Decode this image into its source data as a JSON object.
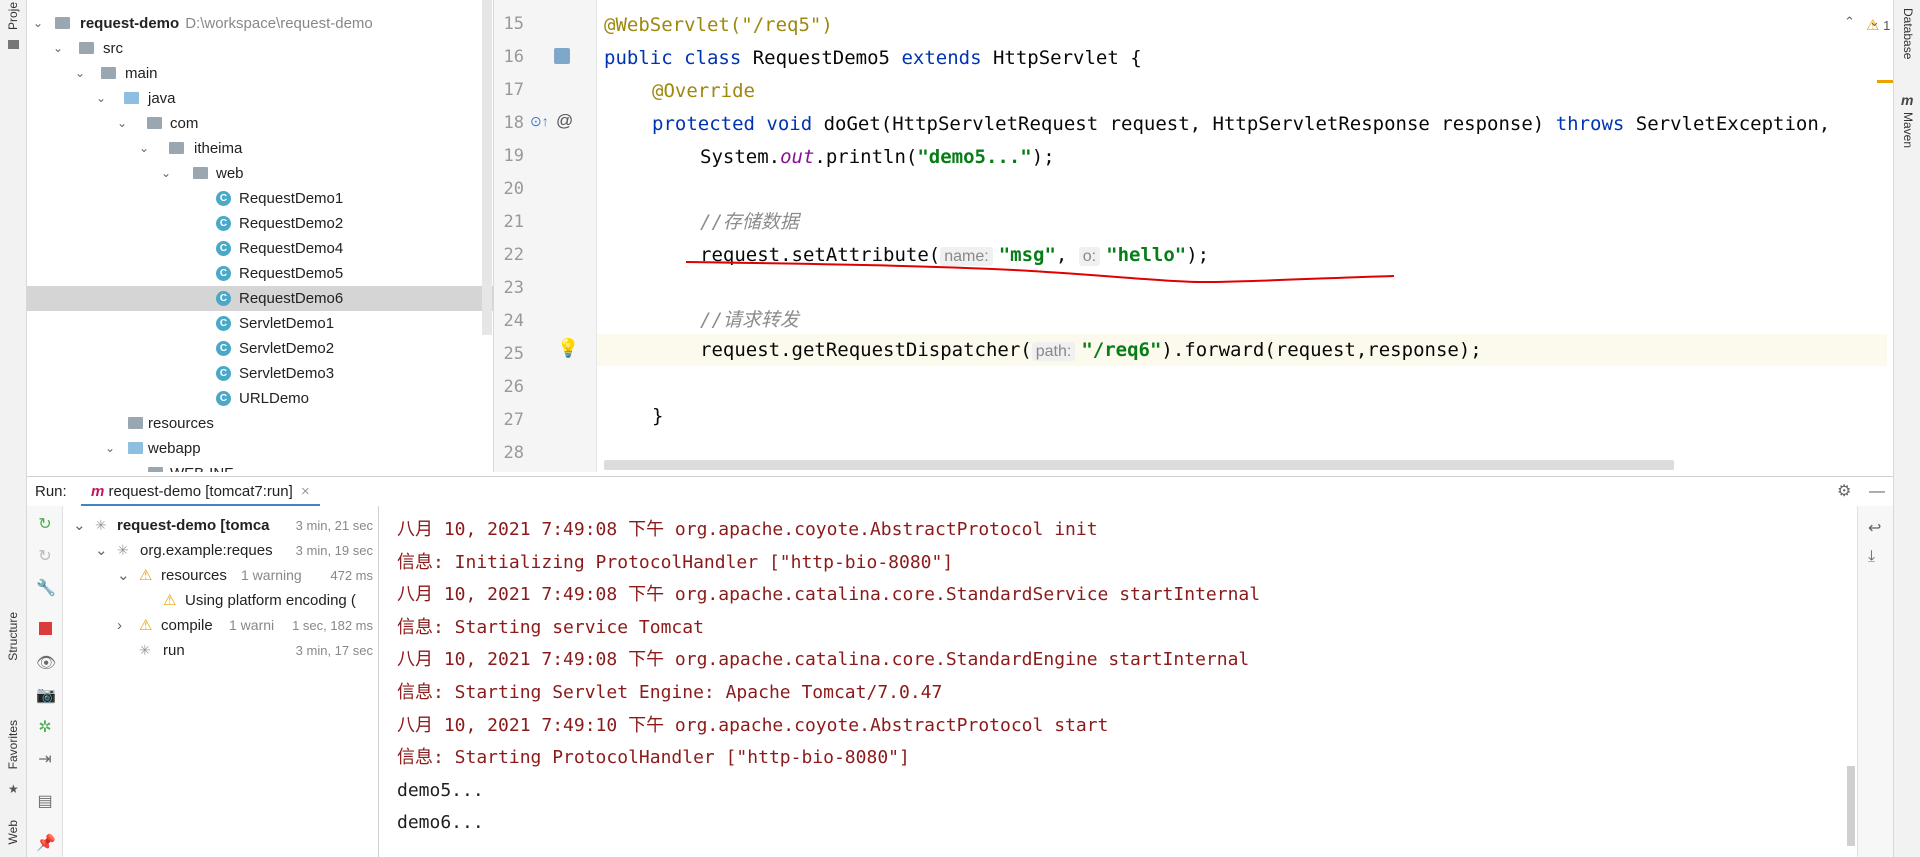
{
  "left_stripe": {
    "project_label": "Proje",
    "structure_label": "Structure",
    "favorites_label": "Favorites",
    "web_label": "Web"
  },
  "right_stripe": {
    "database_label": "Database",
    "maven_label": "Maven"
  },
  "project_tree": {
    "root_name": "request-demo",
    "root_path": "D:\\workspace\\request-demo",
    "items": [
      {
        "label": "src"
      },
      {
        "label": "main"
      },
      {
        "label": "java"
      },
      {
        "label": "com"
      },
      {
        "label": "itheima"
      },
      {
        "label": "web"
      },
      {
        "label": "RequestDemo1"
      },
      {
        "label": "RequestDemo2"
      },
      {
        "label": "RequestDemo4"
      },
      {
        "label": "RequestDemo5"
      },
      {
        "label": "RequestDemo6"
      },
      {
        "label": "ServletDemo1"
      },
      {
        "label": "ServletDemo2"
      },
      {
        "label": "ServletDemo3"
      },
      {
        "label": "URLDemo"
      },
      {
        "label": "resources"
      },
      {
        "label": "webapp"
      },
      {
        "label": "WEB-INF"
      }
    ]
  },
  "editor": {
    "warning_count": "1",
    "line_numbers": [
      "15",
      "16",
      "17",
      "18",
      "19",
      "20",
      "21",
      "22",
      "23",
      "24",
      "25",
      "26",
      "27",
      "28"
    ],
    "code": {
      "l15": "@WebServlet(\"/req5\")",
      "l16_kw": "public class",
      "l16_rest": " RequestDemo5 ",
      "l16_kw2": "extends",
      "l16_end": " HttpServlet {",
      "l17": "@Override",
      "l18_kw": "protected void",
      "l18_rest": " doGet(HttpServletRequest request, HttpServletResponse response) ",
      "l18_kw2": "throws",
      "l18_end": " ServletException,",
      "l19_a": "System.",
      "l19_static": "out",
      "l19_b": ".println(",
      "l19_str": "\"demo5...\"",
      "l19_c": ");",
      "l21_comment": "//存储数据",
      "l22_a": "request.setAttribute(",
      "l22_hint1": "name:",
      "l22_str1": "\"msg\"",
      "l22_sep": ", ",
      "l22_hint2": "o:",
      "l22_str2": "\"hello\"",
      "l22_c": ");",
      "l24_comment": "//请求转发",
      "l25_a": "request.getRequestDispatcher(",
      "l25_hint": "path:",
      "l25_str": "\"/req6\"",
      "l25_c": ").forward(request,response);",
      "l27": "}"
    }
  },
  "run_panel": {
    "run_label": "Run:",
    "tab_label": "request-demo [tomcat7:run]",
    "build_tree": [
      {
        "label": "request-demo [tomca",
        "time": "3 min, 21 sec"
      },
      {
        "label": "org.example:reques",
        "time": "3 min, 19 sec"
      },
      {
        "label": "resources",
        "extra": "1 warning",
        "time": "472 ms"
      },
      {
        "label": "Using platform encoding (",
        "time": ""
      },
      {
        "label": "compile",
        "extra": "1 warni",
        "time": "1 sec, 182 ms"
      },
      {
        "label": "run",
        "time": "3 min, 17 sec"
      }
    ],
    "console_lines": [
      {
        "text": "八月 10, 2021 7:49:08 下午 org.apache.coyote.AbstractProtocol init",
        "style": "red"
      },
      {
        "text": "信息: Initializing ProtocolHandler [\"http-bio-8080\"]",
        "style": "red"
      },
      {
        "text": "八月 10, 2021 7:49:08 下午 org.apache.catalina.core.StandardService startInternal",
        "style": "red"
      },
      {
        "text": "信息: Starting service Tomcat",
        "style": "red"
      },
      {
        "text": "八月 10, 2021 7:49:08 下午 org.apache.catalina.core.StandardEngine startInternal",
        "style": "red"
      },
      {
        "text": "信息: Starting Servlet Engine: Apache Tomcat/7.0.47",
        "style": "red"
      },
      {
        "text": "八月 10, 2021 7:49:10 下午 org.apache.coyote.AbstractProtocol start",
        "style": "red"
      },
      {
        "text": "信息: Starting ProtocolHandler [\"http-bio-8080\"]",
        "style": "red"
      },
      {
        "text": "demo5...",
        "style": "dark"
      },
      {
        "text": "demo6...",
        "style": "dark"
      }
    ]
  },
  "colors": {
    "accent": "#4083c9",
    "annotation_underline": "#e00000",
    "console_red": "#8b1a1a"
  }
}
